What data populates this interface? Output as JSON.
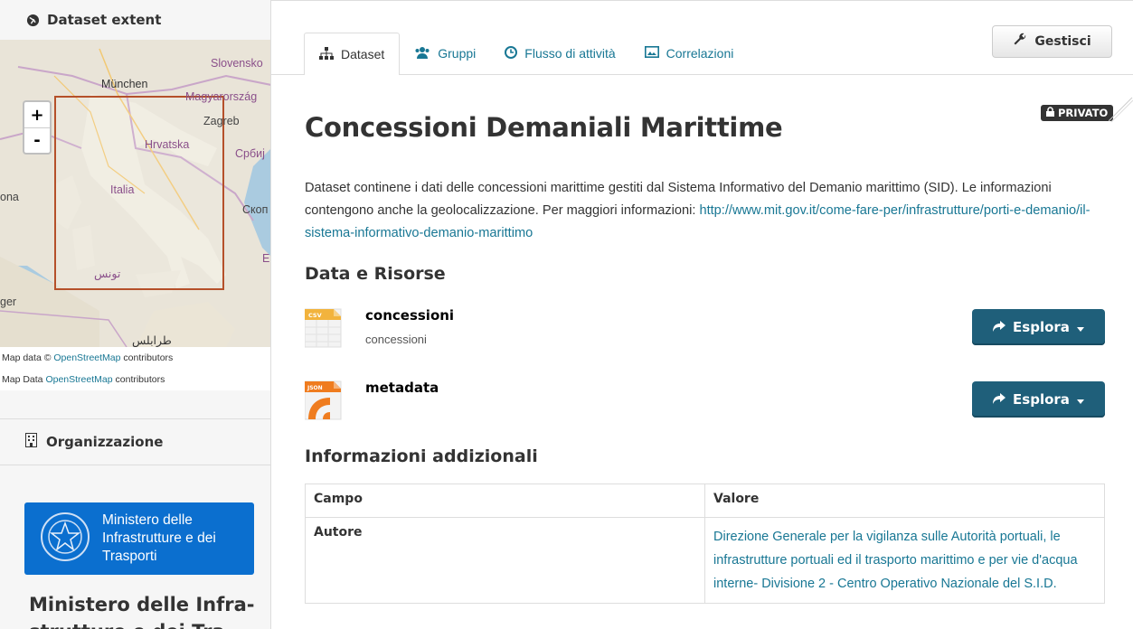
{
  "sidebar": {
    "extent_title": "Dataset extent",
    "map_labels": [
      "Slovensko",
      "München",
      "Magyarország",
      "Zagreb",
      "Hrvatska",
      "Србиј",
      "Italia",
      "Скоп",
      "ona",
      "ger",
      "تونس",
      "طرابلس",
      "E"
    ],
    "zoom_in": "+",
    "zoom_out": "-",
    "attribution_1_prefix": "Map data © ",
    "attribution_1_link": "OpenStreetMap",
    "attribution_1_suffix": " contributors",
    "attribution_2_prefix": "Map Data ",
    "attribution_2_link": "OpenStreetMap",
    "attribution_2_suffix": " contributors",
    "org_title": "Organizzazione",
    "org_logo_lines": [
      "Ministero delle",
      "Infrastrutture e dei",
      "Trasporti"
    ],
    "org_name": "Ministero delle Infra- strutture e dei Tra-"
  },
  "tabs": [
    {
      "label": "Dataset",
      "icon": "sitemap-icon",
      "active": true
    },
    {
      "label": "Gruppi",
      "icon": "users-icon",
      "active": false
    },
    {
      "label": "Flusso di attività",
      "icon": "clock-icon",
      "active": false
    },
    {
      "label": "Correlazioni",
      "icon": "picture-icon",
      "active": false
    }
  ],
  "manage_label": "Gestisci",
  "private_badge": "PRIVATO",
  "title": "Concessioni Demaniali Marittime",
  "description": "Dataset continene i dati delle concessioni marittime gestiti dal Sistema Informativo del Demanio marittimo (SID). Le informazioni contengono anche la geolocalizzazione. Per maggiori informazioni: ",
  "description_link": "http://www.mit.gov.it/come-fare-per/infrastrutture/porti-e-demanio/il-sistema-informativo-demanio-marittimo",
  "resources_title": "Data e Risorse",
  "resources": [
    {
      "format": "CSV",
      "name": "concessioni",
      "description": "concessioni",
      "button": "Esplora"
    },
    {
      "format": "JSON",
      "name": "metadata",
      "description": "",
      "button": "Esplora"
    }
  ],
  "additional_title": "Informazioni addizionali",
  "table": {
    "headers": [
      "Campo",
      "Valore"
    ],
    "rows": [
      {
        "field": "Autore",
        "value": "Direzione Generale per la vigilanza sulle Autorità portuali, le infrastrutture portuali ed il trasporto marittimo e per vie d'acqua interne- Divisione 2 - Centro Operativo Nazionale del S.I.D."
      }
    ]
  },
  "colors": {
    "link": "#187794",
    "button": "#1f5f7a",
    "org_logo": "#0b6fcf"
  }
}
